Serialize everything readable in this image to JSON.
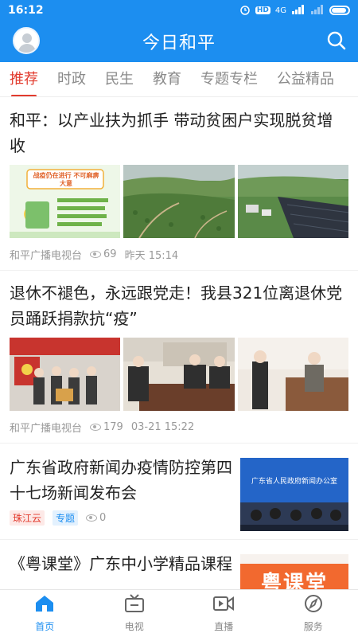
{
  "status_bar": {
    "time": "16:12",
    "network": "4G",
    "hd": "HD"
  },
  "header": {
    "title": "今日和平"
  },
  "tabs": [
    {
      "label": "推荐",
      "active": true
    },
    {
      "label": "时政"
    },
    {
      "label": "民生"
    },
    {
      "label": "教育"
    },
    {
      "label": "专题专栏"
    },
    {
      "label": "公益精品"
    }
  ],
  "articles": [
    {
      "title": "和平：以产业扶为抓手 带动贫困户实现脱贫增收",
      "poster_text": "战疫仍在进行 不可麻痹大意",
      "source": "和平广播电视台",
      "views": "69",
      "time": "昨天 15:14"
    },
    {
      "title": "退休不褪色，永远跟党走！我县321位离退休党员踊跃捐款抗“疫”",
      "source": "和平广播电视台",
      "views": "179",
      "time": "03-21 15:22"
    },
    {
      "title": "广东省政府新闻办疫情防控第四十七场新闻发布会",
      "tag_source": "珠江云",
      "tag_topic": "专题",
      "views": "0",
      "thumb_text": "广东省人民政府新闻办公室"
    },
    {
      "title": "《粤课堂》广东中小学精品课程",
      "thumb_text": "粤课堂"
    }
  ],
  "bottom_nav": [
    {
      "label": "首页",
      "icon": "home-icon",
      "active": true
    },
    {
      "label": "电视",
      "icon": "tv-icon"
    },
    {
      "label": "直播",
      "icon": "live-video-icon"
    },
    {
      "label": "服务",
      "icon": "compass-icon"
    }
  ],
  "colors": {
    "brand": "#1c8ef0",
    "accent": "#e23b2e"
  }
}
